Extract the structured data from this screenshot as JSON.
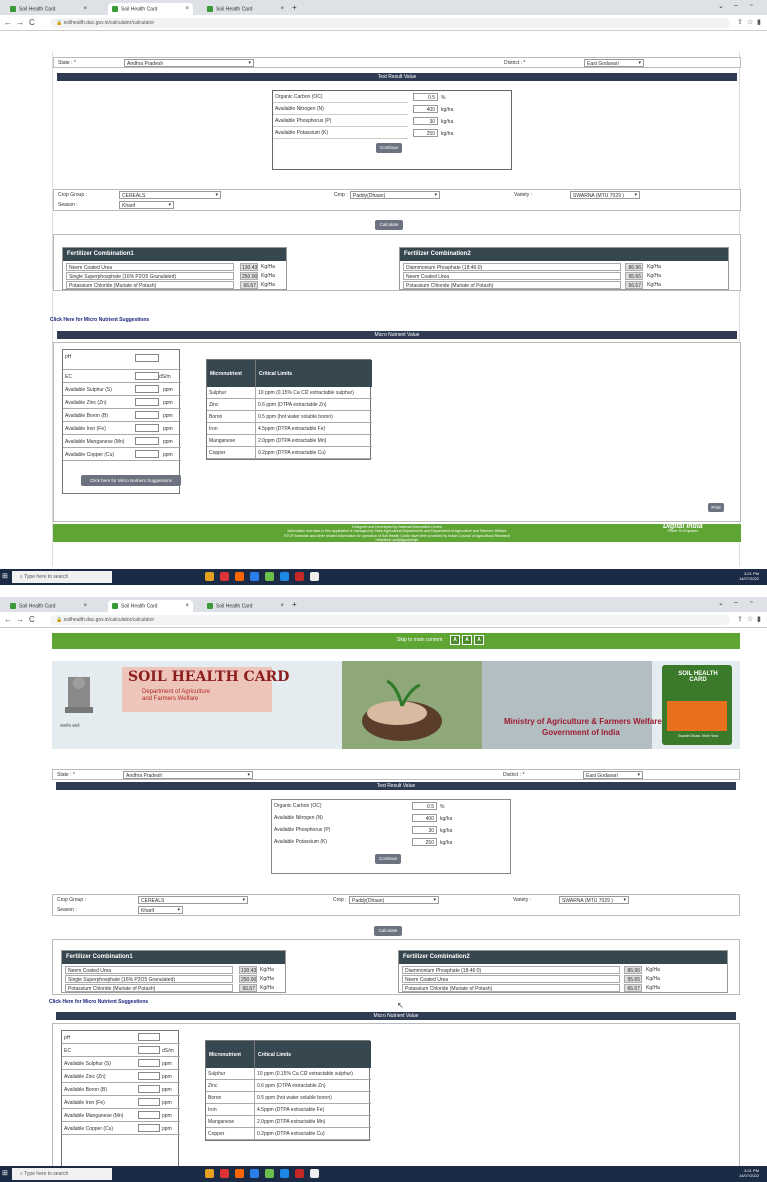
{
  "browser": {
    "tabs": [
      "Soil Health Card",
      "Soil Health Card",
      "Soil Health Card"
    ],
    "url": "soilhealth.dac.gov.in/calculator/calculator"
  },
  "form": {
    "state_label": "State : *",
    "state_value": "Andhra Pradesh",
    "district_label": "District : *",
    "district_value": "East Godavari",
    "test_result_header": "Test Result Value",
    "test_results": [
      {
        "label": "Organic Carbon (OC)",
        "value": "0.5",
        "unit": "%"
      },
      {
        "label": "Available Nitrogen (N)",
        "value": "400",
        "unit": "kg/ha"
      },
      {
        "label": "Available Phosphorus (P)",
        "value": "30",
        "unit": "kg/ha"
      },
      {
        "label": "Available Potassium (K)",
        "value": "250",
        "unit": "kg/ha"
      }
    ],
    "continue_label": "Continue",
    "crop_group_label": "Crop Group :",
    "crop_group_value": "CEREALS",
    "crop_label": "Crop :",
    "crop_value": "Paddy(Dhaan)",
    "variety_label": "Variety :",
    "variety_value": "SWARNA (MTU 7029 )",
    "season_label": "Season :",
    "season_value": "Kharif",
    "calculate_label": "Calculate"
  },
  "combo1": {
    "title": "Fertilizer Combination1",
    "rows": [
      {
        "name": "Neem Coated Urea",
        "value": "130.43",
        "unit": "Kg/Ha"
      },
      {
        "name": "Single Superphosphate (16% P2O5 Granulated)",
        "value": "250.00",
        "unit": "Kg/Ha"
      },
      {
        "name": "Potassium Chloride (Muriate of Potash)",
        "value": "66.67",
        "unit": "Kg/Ha"
      }
    ]
  },
  "combo2": {
    "title": "Fertilizer Combination2",
    "rows": [
      {
        "name": "Diammonium Phosphate (18:46:0)",
        "value": "86.96",
        "unit": "Kg/Ha"
      },
      {
        "name": "Neem Coated Urea",
        "value": "95.65",
        "unit": "Kg/Ha"
      },
      {
        "name": "Potassium Chloride (Muriate of Potash)",
        "value": "66.67",
        "unit": "Kg/Ha"
      }
    ]
  },
  "micro": {
    "link": "Click Here for Micro Nutrient Suggestions",
    "header": "Micro Nutrient Value",
    "inputs": [
      {
        "label": "pH",
        "unit": ""
      },
      {
        "label": "EC",
        "unit": "dS/m"
      },
      {
        "label": "Available Sulphur (S)",
        "unit": "ppm"
      },
      {
        "label": "Available Zinc (Zn)",
        "unit": "ppm"
      },
      {
        "label": "Available Boron (B)",
        "unit": "ppm"
      },
      {
        "label": "Available Iron (Fe)",
        "unit": "ppm"
      },
      {
        "label": "Available Manganese (Mn)",
        "unit": "ppm"
      },
      {
        "label": "Available Copper (Cu)",
        "unit": "ppm"
      }
    ],
    "button": "Click here for Micro Nutrient Suggestions",
    "table_head": [
      "Micronutrient",
      "Critical Limits"
    ],
    "table_rows": [
      [
        "Sulphur",
        "10 ppm (0.15% Ca Cl2 extractable sulphur)"
      ],
      [
        "Zinc",
        "0.6 ppm (DTPA extractable Zn)"
      ],
      [
        "Boron",
        "0.5 ppm (hot water soluble boron)"
      ],
      [
        "Iron",
        "4.5ppm (DTPA extractable Fe)"
      ],
      [
        "Manganese",
        "2.0ppm (DTPA extractable Mn)"
      ],
      [
        "Copper",
        "0.2ppm (DTPA extractable Cu)"
      ]
    ],
    "print_label": "Print"
  },
  "footer": {
    "line1": "Designed and Developed by National Informatics Centre",
    "line2": "Information and data in this application is managed by State Agricultural Departments and Department of Agriculture and Farmers Welfare",
    "line3": "STCR formulae and other related information for operation of Soil Health Cards have been provided by Indian Council of Agricultural Research",
    "line4": "Helpdesk: soil[at]gov[dot]in",
    "digital_india": "Digital India",
    "digital_india_sub": "Power To Empower"
  },
  "header2": {
    "skip": "Skip to main content",
    "text_size": [
      "A",
      "A",
      "A"
    ],
    "title": "SOIL HEALTH CARD",
    "dept1": "Department of Agriculture",
    "dept2": "and Farmers Welfare",
    "ministry1": "Ministry of Agriculture & Farmers Welfare",
    "ministry2": "Government of India",
    "logo_text": "SOIL HEALTH CARD",
    "emblem_text": "सत्यमेव जयते",
    "shc_tag": "Swasth Dhara. Khet Hara"
  },
  "taskbar": {
    "search": "Type here to search",
    "time": "3:21 PM",
    "date": "14/07/2022"
  }
}
